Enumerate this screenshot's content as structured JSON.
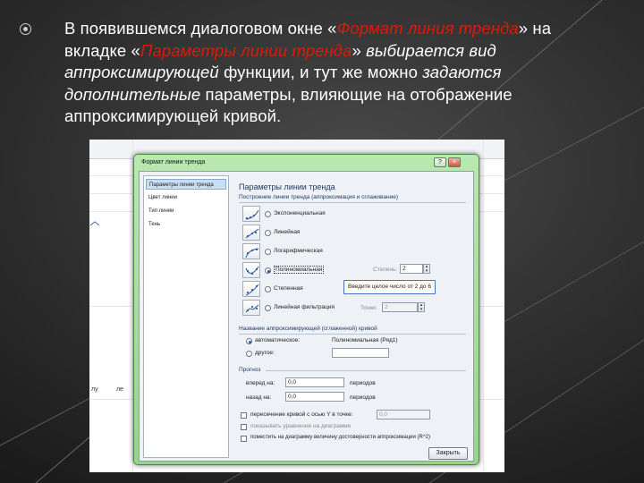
{
  "slide": {
    "para_part1": "В появившемся диалоговом окне «",
    "para_dialog_name": "Формат линия тренда",
    "para_part2": "» на вкладке «",
    "para_tab_name": "Параметры линии тренда",
    "para_part3": "» ",
    "para_italic": "выбирается вид аппроксимирующей",
    "para_part4": " функции, и тут же можно ",
    "para_italic2": "задаются дополнительные",
    "para_part5": " параметры, влияющие на отображение аппроксимирующей кривой."
  },
  "dialog": {
    "title": "Формат линии тренда",
    "help_glyph": "?",
    "close_glyph": "×",
    "sidebar": [
      {
        "label": "Параметры линии тренда",
        "selected": true
      },
      {
        "label": "Цвет линии",
        "selected": false
      },
      {
        "label": "Тип линии",
        "selected": false
      },
      {
        "label": "Тень",
        "selected": false
      }
    ],
    "panel_title": "Параметры линии тренда",
    "group_type": "Построение линии тренда (аппроксимация и сглаживание)",
    "types": [
      {
        "label": "Экспоненциальная",
        "selected": false,
        "icon": "exponential-icon"
      },
      {
        "label": "Линейная",
        "selected": false,
        "icon": "linear-icon"
      },
      {
        "label": "Логарифмическая",
        "selected": false,
        "icon": "logarithmic-icon"
      },
      {
        "label": "Полиномиальная",
        "selected": true,
        "icon": "polynomial-icon"
      },
      {
        "label": "Степенная",
        "selected": false,
        "icon": "power-icon"
      },
      {
        "label": "Линейная фильтрация",
        "selected": false,
        "icon": "moving-average-icon"
      }
    ],
    "degree_label": "Степень:",
    "degree_value": "2",
    "tooltip": "Введите целое число от 2 до 6",
    "period_label": "Точки:",
    "period_value": "2",
    "group_name": "Название аппроксимирующей (сглаженной) кривой",
    "name_auto": "автоматическое:",
    "name_auto_value": "Полиномиальная (Ряд1)",
    "name_custom": "другое:",
    "group_forecast": "Прогноз",
    "forward_label": "вперед на:",
    "forward_value": "0,0",
    "forward_unit": "периодов",
    "back_label": "назад на:",
    "back_value": "0,0",
    "back_unit": "периодов",
    "checks": [
      {
        "label": "пересечение кривой с осью Y в точке:",
        "value": "0,0",
        "enabled": true
      },
      {
        "label": "показывать уравнение на диаграмме",
        "enabled": false
      },
      {
        "label": "поместить на диаграмму величину достоверности аппроксимации (R^2)",
        "enabled": true
      }
    ],
    "close_button": "Закрыть"
  },
  "background_sheet": {
    "fragments": [
      "лу",
      "ле"
    ]
  }
}
